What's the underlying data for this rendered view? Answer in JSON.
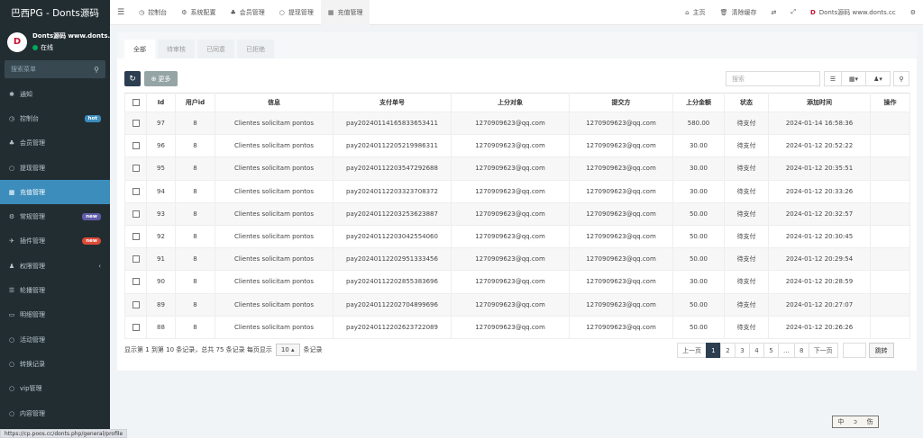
{
  "brand": {
    "title": "巴西PG - Donts源码"
  },
  "user": {
    "avatar_text": "D",
    "name": "Donts源码 www.donts.cc",
    "status": "在线"
  },
  "sidebar_search": {
    "placeholder": "搜索菜单"
  },
  "sidebar": {
    "items": [
      {
        "label": "通知",
        "icon": "✱",
        "badge": ""
      },
      {
        "label": "控制台",
        "icon": "◷",
        "badge": "hot"
      },
      {
        "label": "会员管理",
        "icon": "♣",
        "badge": ""
      },
      {
        "label": "提现管理",
        "icon": "○",
        "badge": ""
      },
      {
        "label": "充值管理",
        "icon": "▦",
        "badge": ""
      },
      {
        "label": "常规管理",
        "icon": "⚙",
        "badge": "new"
      },
      {
        "label": "插件管理",
        "icon": "✈",
        "badge": "new"
      },
      {
        "label": "权限管理",
        "icon": "♟",
        "badge": ""
      },
      {
        "label": "轮播管理",
        "icon": "☰",
        "badge": ""
      },
      {
        "label": "明细管理",
        "icon": "▭",
        "badge": ""
      },
      {
        "label": "活动管理",
        "icon": "○",
        "badge": ""
      },
      {
        "label": "转换记录",
        "icon": "○",
        "badge": ""
      },
      {
        "label": "vip管理",
        "icon": "○",
        "badge": ""
      },
      {
        "label": "内容管理",
        "icon": "○",
        "badge": ""
      }
    ]
  },
  "topnav": {
    "toggle": "☰",
    "tabs": [
      {
        "label": "控制台",
        "icon": "◷"
      },
      {
        "label": "系统配置",
        "icon": "⚙"
      },
      {
        "label": "会员管理",
        "icon": "♣"
      },
      {
        "label": "提现管理",
        "icon": "○"
      },
      {
        "label": "充值管理",
        "icon": "▦"
      }
    ],
    "right": {
      "home": "主页",
      "clear_cache": "清除缓存",
      "site_name": "Donts源码 www.donts.cc"
    }
  },
  "subtabs": [
    "全部",
    "待审核",
    "已同意",
    "已拒绝"
  ],
  "toolbar": {
    "more_label": "更多",
    "search_placeholder": "搜索"
  },
  "table": {
    "headers": [
      "Id",
      "用户id",
      "信息",
      "支付单号",
      "上分对象",
      "提交方",
      "上分金额",
      "状态",
      "添加时间",
      "操作"
    ],
    "rows": [
      [
        "97",
        "8",
        "Clientes solicitam pontos",
        "pay20240114165833653411",
        "1270909623@qq.com",
        "1270909623@qq.com",
        "580.00",
        "待支付",
        "2024-01-14 16:58:36"
      ],
      [
        "96",
        "8",
        "Clientes solicitam pontos",
        "pay20240112205219986311",
        "1270909623@qq.com",
        "1270909623@qq.com",
        "30.00",
        "待支付",
        "2024-01-12 20:52:22"
      ],
      [
        "95",
        "8",
        "Clientes solicitam pontos",
        "pay20240112203547292688",
        "1270909623@qq.com",
        "1270909623@qq.com",
        "30.00",
        "待支付",
        "2024-01-12 20:35:51"
      ],
      [
        "94",
        "8",
        "Clientes solicitam pontos",
        "pay20240112203323708372",
        "1270909623@qq.com",
        "1270909623@qq.com",
        "30.00",
        "待支付",
        "2024-01-12 20:33:26"
      ],
      [
        "93",
        "8",
        "Clientes solicitam pontos",
        "pay20240112203253623887",
        "1270909623@qq.com",
        "1270909623@qq.com",
        "50.00",
        "待支付",
        "2024-01-12 20:32:57"
      ],
      [
        "92",
        "8",
        "Clientes solicitam pontos",
        "pay20240112203042554060",
        "1270909623@qq.com",
        "1270909623@qq.com",
        "50.00",
        "待支付",
        "2024-01-12 20:30:45"
      ],
      [
        "91",
        "8",
        "Clientes solicitam pontos",
        "pay20240112202951333456",
        "1270909623@qq.com",
        "1270909623@qq.com",
        "50.00",
        "待支付",
        "2024-01-12 20:29:54"
      ],
      [
        "90",
        "8",
        "Clientes solicitam pontos",
        "pay20240112202855383696",
        "1270909623@qq.com",
        "1270909623@qq.com",
        "30.00",
        "待支付",
        "2024-01-12 20:28:59"
      ],
      [
        "89",
        "8",
        "Clientes solicitam pontos",
        "pay20240112202704899696",
        "1270909623@qq.com",
        "1270909623@qq.com",
        "50.00",
        "待支付",
        "2024-01-12 20:27:07"
      ],
      [
        "88",
        "8",
        "Clientes solicitam pontos",
        "pay20240112202623722089",
        "1270909623@qq.com",
        "1270909623@qq.com",
        "50.00",
        "待支付",
        "2024-01-12 20:26:26"
      ]
    ]
  },
  "footer": {
    "info_prefix": "显示第 1 到第 10 条记录，总共 75 条记录 每页显示",
    "page_size": "10 ▴",
    "info_suffix": "条记录"
  },
  "pagination": {
    "pages": [
      "上一页",
      "1",
      "2",
      "3",
      "4",
      "5",
      "...",
      "8",
      "下一页"
    ],
    "active": "1",
    "jump_label": "跳转"
  },
  "statusbar": {
    "url": "https://cp.poos.cc/donts.php/general/profile"
  },
  "stamp": [
    "中",
    "ↄ",
    "伤"
  ]
}
